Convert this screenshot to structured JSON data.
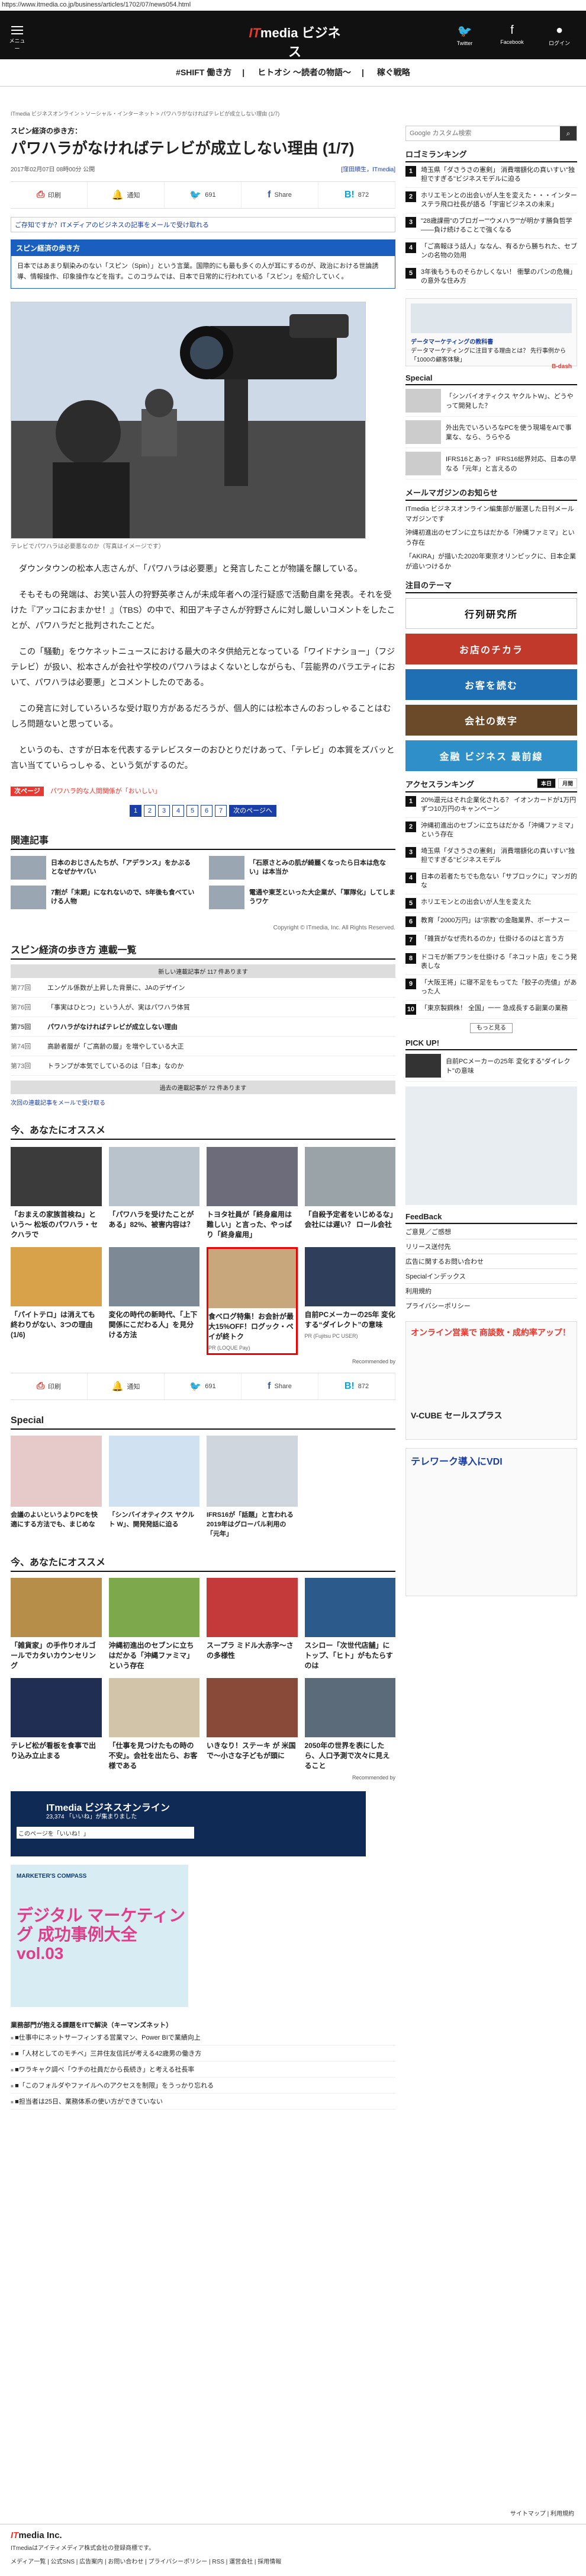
{
  "browser": {
    "url": "https://www.itmedia.co.jp/business/articles/1702/07/news054.html"
  },
  "header": {
    "menu_label": "メニュー",
    "logo_main": "ITmedia ビジネス",
    "logo_it": "IT",
    "logo_sub": "ONLINE",
    "twitter": "Twitter",
    "facebook": "Facebook",
    "login": "ログイン"
  },
  "topnav": [
    "#SHIFT 働き方",
    "ヒトオシ ～読者の物語～",
    "稼ぐ戦略"
  ],
  "breadcrumb": "ITmedia ビジネスオンライン > ソーシャル・インターネット > パワハラがなければテレビが成立しない理由 (1/7)",
  "article": {
    "kicker": "スピン経済の歩き方：",
    "title": "パワハラがなければテレビが成立しない理由 (1/7)",
    "date": "2017年02月07日 08時00分 公開",
    "author": "[窪田順生，ITmedia]",
    "share": {
      "print": "印刷",
      "notify": "通知",
      "count1": "691",
      "share": "Share",
      "hb": "B!",
      "hb_count": "872"
    },
    "note": "ご存知ですか？ITメディアのビジネスの記事をメールで受け取れる",
    "series_head": "スピン経済の歩き方",
    "series_text": "日本ではあまり馴染みのない「スピン（Spin）」という言葉。国際的にも最も多くの人が耳にするのが、政治における世論誘導、情報操作、印象操作などを指す。このコラムでは、日本で日常的に行われている「スピン」を紹介していく。",
    "photo_caption": "テレビでパワハラは必要悪なのか（写真はイメージです）",
    "paragraphs": [
      "ダウンタウンの松本人志さんが、「パワハラは必要悪」と発言したことが物議を醸している。",
      "そもそもの発端は、お笑い芸人の狩野英孝さんが未成年者への淫行疑惑で活動自粛を発表。それを受けた『アッコにおまかせ！』（TBS）の中で、和田アキ子さんが狩野さんに対し厳しいコメントをしたことが、パワハラだと批判されたことだ。",
      "この「騒動」をウケネットニュースにおける最大のネタ供給元となっている「ワイドナショー」（フジテレビ）が扱い、松本さんが会社や学校のパワハラはよくないとしながらも、「芸能界のバラエティにおいて、パワハラは必要悪」とコメントしたのである。",
      "この発言に対していろいろな受け取り方があるだろうが、個人的には松本さんのおっしゃることはむしろ問題ないと思っている。",
      "というのも、さすが日本を代表するテレビスターのおひとりだけあって、「テレビ」の本質をズバッと言い当てていらっしゃる、という気がするのだ。"
    ],
    "tag": "次ページ",
    "tag_link": "パワハラ的な人間関係が「おいしい」",
    "pages": [
      "1",
      "2",
      "3",
      "4",
      "5",
      "6",
      "7"
    ],
    "next": "次のページへ"
  },
  "related": {
    "head": "関連記事",
    "items": [
      "日本のおじさんたちが、「アデランス」をかぶるとなぜかヤバい",
      "「石原さとみの肌が綺麗くなったら日本は危ない」は本当か",
      "7割が「末期」になれないので、5年後も食べていける人物",
      "電通や東芝といった大企業が、「軍隊化」してしまうワケ"
    ]
  },
  "copyright": "Copyright © ITmedia, Inc. All Rights Reserved.",
  "series_list": {
    "head": "スピン経済の歩き方 連載一覧",
    "more_top": "新しい連載記事が 117 件あります",
    "rows": [
      {
        "n": "第77回",
        "t": "エンゲル係数が上昇した背景に、JAのデザイン"
      },
      {
        "n": "第76回",
        "t": "「事実はひとつ」という人が、実はパワハラ体質"
      },
      {
        "n": "第75回",
        "t": "パワハラがなければテレビが成立しない理由"
      },
      {
        "n": "第74回",
        "t": "高齢者層が「ご高齢の層」を増やしている大正"
      },
      {
        "n": "第73回",
        "t": "トランプが本気でしているのは「日本」なのか"
      }
    ],
    "more_bottom": "過去の連載記事が 72 件あります",
    "alert": "次回の連載記事をメールで受け取る"
  },
  "recommend": {
    "head": "今、あなたにオススメ",
    "items": [
      {
        "t": "「おまえの家族首検ね」という～ 松坂のパワハラ・セクハラで",
        "p": ""
      },
      {
        "t": "「パワハラを受けたことがある」82%、被害内容は？",
        "p": ""
      },
      {
        "t": "トヨタ社員が「終身雇用は難しい」と言った、やっぱり「終身雇用」",
        "p": ""
      },
      {
        "t": "「自殺予定者をいじめるな」会社には遅い？ ロール会社",
        "p": ""
      },
      {
        "t": "「パイトテロ」は消えても終わりがない、3つの理由 (1/6)",
        "p": ""
      },
      {
        "t": "変化の時代の新時代、「上下関係にこだわる人」を見分ける方法",
        "p": ""
      },
      {
        "t": "食べログ特集！お会計が最大15%OFF！ログック・ペイが終トク",
        "p": "PR (LOQUE Pay)"
      },
      {
        "t": "自前PCメーカーの25年 変化する“ダイレクト”の意味",
        "p": "PR (Fujitsu PC USER)"
      }
    ],
    "by": "Recommended by"
  },
  "share_bottom": {
    "print": "印刷",
    "notify": "通知",
    "count1": "691",
    "share": "Share",
    "hb": "B!",
    "hb_count": "872"
  },
  "special": {
    "head": "Special",
    "items": [
      "会議のよいというよりPCを快適にする方法でも、まじめな",
      "「シンバイオティクス ヤクルト W」、開発発話に迫る",
      "IFRS16が「話題」と言われる 2019年はグローバル利用の「元年」",
      ""
    ]
  },
  "recommend2": {
    "head": "今、あなたにオススメ",
    "items": [
      "「雑貨家」の手作りオルゴールでカタいカウンセリング",
      "沖縄初進出のセブンに立ちはだかる「沖縄ファミマ」という存在",
      "スープラ ミドル大赤字～さの多様性",
      "スシロー「次世代店舗」にトップ、「ヒト」がもたらすのは",
      "テレビ松が看板を食事で出り込み立止まる",
      "「仕事を見つけたもの時の不安」。会社を出たら、お客様である",
      "いきなり！ステーキ が 米国で～小さな子どもが頭に",
      "2050年の世界を表にしたら、人口予測で次々に見えること"
    ],
    "by": "Recommended by"
  },
  "banner": {
    "t": "ITmedia ビジネスオンライン",
    "s": "23,374 「いいね」が集まりました",
    "i": "このページを「いいね！」"
  },
  "ad": {
    "brand": "MARKETER'S COMPASS",
    "t": "デジタル マーケティング 成功事例大全 vol.03"
  },
  "links": {
    "head": "業務部門が抱える課題をITで解決（キーマンズネット）",
    "items": [
      "■仕事中にネットサーフィンする営業マン、Power BIで業績向上",
      "■「人材としてのモチベ」三井住友信託が考える42歳男の働き方",
      "■ワラキャク調べ「ウチの社員だから長続き」と考える社長率",
      "■「このフォルダやファイルへのアクセスを制限」をうっかり忘れる",
      "■担当者は25日、業務体系の使い方ができていない"
    ]
  },
  "footer": {
    "logo": "ITmedia Inc.",
    "logo_it": "IT",
    "sub": "ITmediaはアイティメディア株式会社の登録商標です。",
    "menu": "メディア一覧 | 公式SNS | 広告案内 | お問い合わせ | プライバシーポリシー | RSS | 運営会社 | 採用情報",
    "sitemap": "サイトマップ | 利用規約"
  },
  "sidebar": {
    "search_placeholder": "Google カスタム検索",
    "ranking_head": "ロゴミランキング",
    "ranking": [
      "埼玉県「ダさうさの憲剣」 消費増額化の真いすい\"独担ですぎる\"ビジネスモデルに迫る",
      "ホリエモンとの出会いが人生を変えた・・・インターステラ飛ロ社長が語る「宇宙ビジネスの未来」",
      "\"28歳課冊\"のブロガー\"\"ウメハラ\"\"が明かす勝負哲学――負け続けることで強くなる",
      "「ご高報ほう話人」ななん、有るから勝ちれた、セブンの名物の効用",
      "3年後もうものそらかしくない！ 衝撃のパンの危機」の意外な住み方"
    ],
    "ad1": {
      "t": "データマーケティングの教科書",
      "s": "データマーケティングに注目する理由とは？ 先行事例から「1000の顧客体験」",
      "b": "B-dash"
    },
    "special_head": "Special",
    "special": [
      "「シンバイオティクス ヤクルトW」、どうやって開発した？",
      "外出先でいろいろなPCを使う現場をAIで事業な、なら、うらやる",
      "IFRS16とあっ？ IFRS16総界対応、日本の早なる「元年」と言えるの"
    ],
    "mail_head": "メールマガジンのお知らせ",
    "mail_items": [
      "ITmedia ビジネスオンライン編集部が厳選した日刊メールマガジンです",
      "沖縄初進出のセブンに立ちはだかる「沖縄ファミマ」という存在",
      "「AKIRA」が描いた2020年東京オリンピックに、日本企業が追いつけるか"
    ],
    "theme_head": "注目のテーマ",
    "banners": [
      "行列研究所",
      "お店のチカラ",
      "お客を読む",
      "会社の数字",
      "金融 ビジネス 最前線"
    ],
    "access_head": "アクセスランキング",
    "access_tabs": [
      "本日",
      "月間"
    ],
    "access": [
      "20%還元はそれ企業化される？ イオンカードが1万円ずつ10万円のキャンペーン",
      "沖縄初進出のセブンに立ちはだかる「沖縄ファミマ」という存在",
      "埼玉県「ダさうさの憲剣」 消費増額化の真いすい\"独担ですぎる\"ビジネスモデル",
      "日本の若者たちでも危ない「サブロックに」マンガ的な",
      "ホリエモンとの出会いが人生を変えた",
      "教育「2000万円」は“宗教”の金融業界、ボーナスー",
      "「雑貨がなぜ売れるのか」仕掛けるのはと言う方",
      "ドコモが新プランを仕掛ける「ネコット店」をこう発表しな",
      "「大阪王将」に寝不足をもってた「餃子の売値」があった人",
      "「東京製鋼株！ 全国」一一 急成長する副業の業務"
    ],
    "access_more": "もっと見る",
    "pickup_head": "PICK UP!",
    "pickup": "自前PCメーカーの25年 変化する\"ダイレクト\"の意味",
    "feedback_head": "FeedBack",
    "feedback": [
      "ご意見／ご感想",
      "リリース送付先",
      "広告に関するお問い合わせ",
      "Specialインデックス",
      "利用規約",
      "プライバシーポリシー"
    ],
    "ad3": {
      "t": "オンライン営業で 商談数・成約率アップ！",
      "b": "V-CUBE セールスプラス"
    },
    "ad4": {
      "t": "テレワーク導入にVDI"
    }
  }
}
